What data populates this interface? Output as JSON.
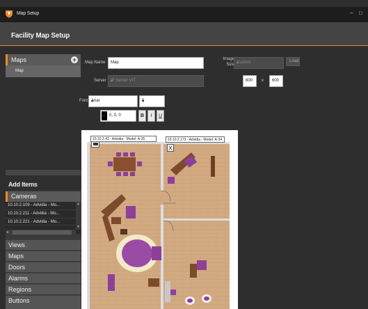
{
  "window": {
    "title": "Map Setup",
    "minimize_glyph": "–",
    "maximize_glyph": "□",
    "logo_icon": "shield-logo"
  },
  "header": {
    "title": "Facility Map Setup"
  },
  "colors": {
    "accent": "#f0892b",
    "header_bg": "#444444",
    "panel_bg": "#2e2e2e"
  },
  "sidebar": {
    "maps_title": "Maps",
    "maps_items": [
      "Map"
    ],
    "add_items_title": "Add Items",
    "cameras_title": "Cameras",
    "cameras": [
      "10.10.2.109 - Advidia - Mo...",
      "10.10.2.211 - Advidia - Mo...",
      "10.10.2.221 - Advidia - Mo..."
    ],
    "categories": [
      "Views",
      "Maps",
      "Doors",
      "Alarms",
      "Regions",
      "Buttons"
    ]
  },
  "form": {
    "map_name_label": "Map Name",
    "map_name_value": "Map",
    "server_label": "Server",
    "server_value": "IP Server VIT",
    "image_size_label": "Image Size",
    "image_size_value": "Custom",
    "load_button": "Load",
    "width_value": "600",
    "times": "x",
    "height_value": "600",
    "font_label": "Font",
    "font_value": "Arial",
    "font_size_value": "8",
    "color_value": "0, 0, 0",
    "bold_label": "B",
    "italic_label": "I",
    "underline_label": "U"
  },
  "map_canvas": {
    "camera_labels": [
      "10.10.2.43 - Advidia - Model: A-35",
      "10.10.2.173 - Advidia - Model: A-34"
    ],
    "close_glyph": "X"
  }
}
